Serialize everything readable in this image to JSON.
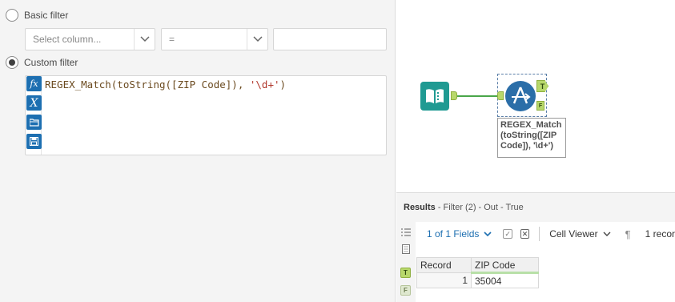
{
  "config": {
    "basic_filter_label": "Basic filter",
    "select_column_placeholder": "Select column...",
    "operator_value": "=",
    "value_input": "",
    "custom_filter_label": "Custom filter",
    "selected_mode": "custom",
    "expression": {
      "prefix": "REGEX_Match(toString([ZIP Code]), ",
      "string": "'\\d+'",
      "suffix": ")"
    }
  },
  "canvas": {
    "annotation": "REGEX_Match\n(toString([ZIP\nCode]), '\\d+')",
    "true_anchor": "T",
    "false_anchor": "F"
  },
  "results": {
    "title": "Results",
    "subtitle": "- Filter (2) - Out - True",
    "fields_label": "1 of 1 Fields",
    "cell_viewer_label": "Cell Viewer",
    "record_count_label": "1 recor",
    "side_badges": [
      "T",
      "F"
    ],
    "columns": [
      "Record",
      "ZIP Code"
    ],
    "rows": [
      [
        "1",
        "35004"
      ]
    ]
  },
  "colors": {
    "accent_blue": "#1d6fb1",
    "connection_green": "#4aa64a",
    "anchor_green": "#b8d86b",
    "input_tool_teal": "#1f9a92",
    "filter_tool_blue": "#2b6ea8"
  }
}
